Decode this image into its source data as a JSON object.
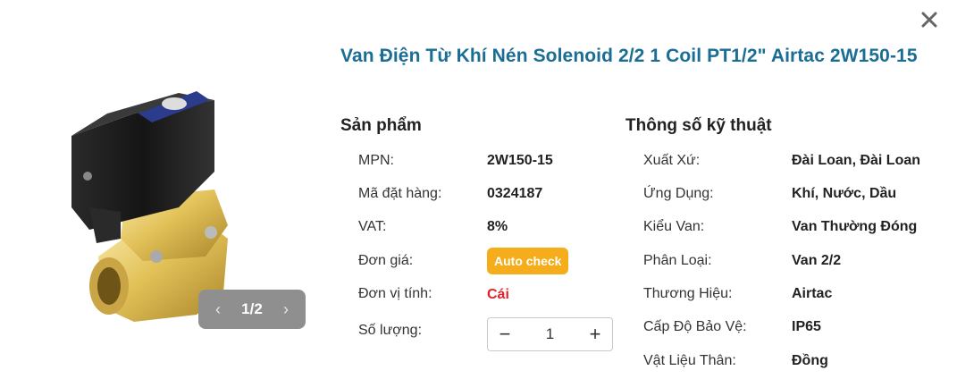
{
  "title": "Van Điện Từ Khí Nén Solenoid 2/2 1 Coil PT1/2\" Airtac 2W150-15",
  "gallery": {
    "counter": "1/2",
    "prev_icon": "chevron-left-icon",
    "next_icon": "chevron-right-icon"
  },
  "product": {
    "heading": "Sản phẩm",
    "mpn_label": "MPN:",
    "mpn_value": "2W150-15",
    "order_label": "Mã đặt hàng:",
    "order_value": "0324187",
    "vat_label": "VAT:",
    "vat_value": "8%",
    "price_label": "Đơn giá:",
    "price_button": "Auto check",
    "unit_label": "Đơn vị tính:",
    "unit_value": "Cái",
    "qty_label": "Số lượng:",
    "qty_value": "1",
    "minus": "−",
    "plus": "+"
  },
  "specs": {
    "heading": "Thông số kỹ thuật",
    "rows": [
      {
        "label": "Xuất Xứ:",
        "value": "Đài Loan, Đài Loan"
      },
      {
        "label": "Ứng Dụng:",
        "value": "Khí, Nước, Dầu"
      },
      {
        "label": "Kiểu Van:",
        "value": "Van Thường Đóng"
      },
      {
        "label": "Phân Loại:",
        "value": "Van 2/2"
      },
      {
        "label": "Thương Hiệu:",
        "value": "Airtac"
      },
      {
        "label": "Cấp Độ Bảo Vệ:",
        "value": "IP65"
      },
      {
        "label": "Vật Liệu Thân:",
        "value": "Đồng"
      }
    ]
  },
  "colors": {
    "title": "#1a6d94",
    "accent": "#f5ad1c",
    "unit": "#e0232a",
    "pager": "#8f8f8f"
  }
}
